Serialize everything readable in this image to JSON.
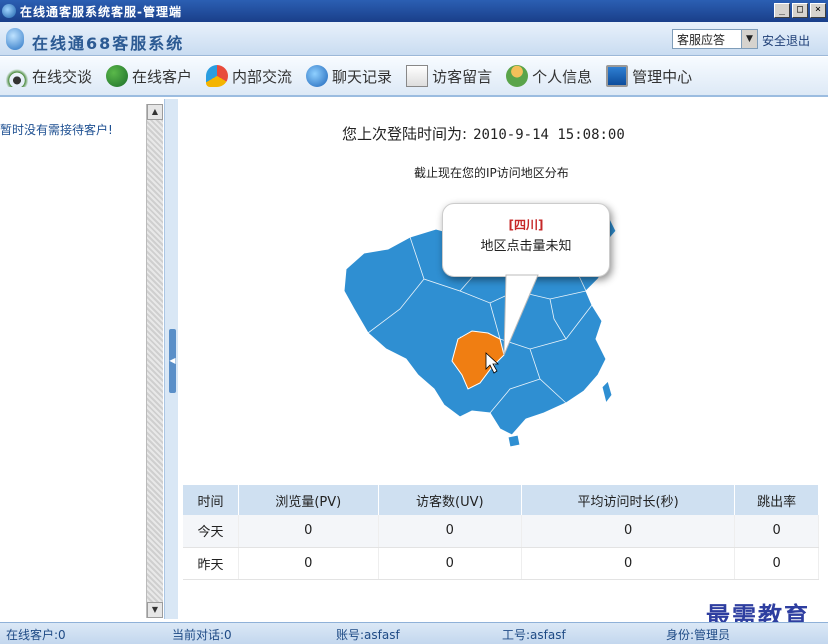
{
  "window": {
    "title": "在线通客服系统客服-管理端",
    "btn_min": "_",
    "btn_max": "□",
    "btn_close": "×"
  },
  "header": {
    "title": "在线通68客服系统",
    "status_selected": "客服应答",
    "logout": "安全退出"
  },
  "nav": [
    {
      "label": "在线交谈",
      "icon": "signal-icon"
    },
    {
      "label": "在线客户",
      "icon": "users-icon"
    },
    {
      "label": "内部交流",
      "icon": "chat-icon"
    },
    {
      "label": "聊天记录",
      "icon": "records-icon"
    },
    {
      "label": "访客留言",
      "icon": "message-icon"
    },
    {
      "label": "个人信息",
      "icon": "person-icon"
    },
    {
      "label": "管理中心",
      "icon": "monitor-icon"
    }
  ],
  "sidebar": {
    "empty_text": "暂时没有需接待客户!"
  },
  "main": {
    "last_login_label": "您上次登陆时间为:",
    "last_login_value": "2010-9-14 15:08:00",
    "map_title": "截止现在您的IP访问地区分布",
    "callout_region": "[四川]",
    "callout_text": "地区点击量未知",
    "highlight_color": "#f07e12",
    "map_color": "#2f8fd2"
  },
  "stats": {
    "headers": [
      "时间",
      "浏览量(PV)",
      "访客数(UV)",
      "平均访问时长(秒)",
      "跳出率"
    ],
    "rows": [
      [
        "今天",
        "0",
        "0",
        "0",
        "0"
      ],
      [
        "昨天",
        "0",
        "0",
        "0",
        "0"
      ]
    ]
  },
  "footer": {
    "online_customers": "在线客户:0",
    "current_chats": "当前对话:0",
    "account": "账号:asfasf",
    "job_no": "工号:asfasf",
    "identity": "身份:管理员"
  },
  "watermark": "最需教育"
}
